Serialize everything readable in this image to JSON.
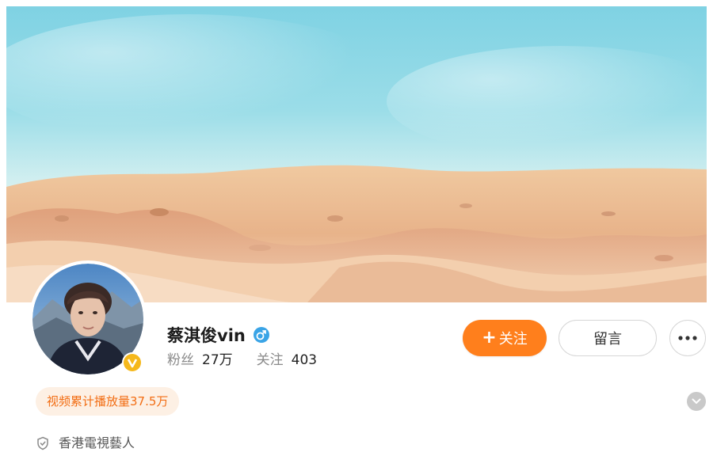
{
  "profile": {
    "name": "蔡淇俊vin",
    "avatar_badge": "V",
    "verified_icon": "male-gender-icon",
    "stats": {
      "followers_label": "粉丝",
      "followers_value": "27万",
      "following_label": "关注",
      "following_value": "403"
    },
    "achievement": "视频累计播放量37.5万",
    "bio": "香港電視藝人"
  },
  "actions": {
    "follow_label": "关注",
    "message_label": "留言",
    "more_icon": "ellipsis-icon"
  },
  "colors": {
    "accent": "#ff7f1c",
    "pill_bg": "#fdf0e4",
    "pill_text": "#f26d13",
    "verified_blue": "#3aa4e6",
    "badge_gold": "#f5b81c"
  }
}
